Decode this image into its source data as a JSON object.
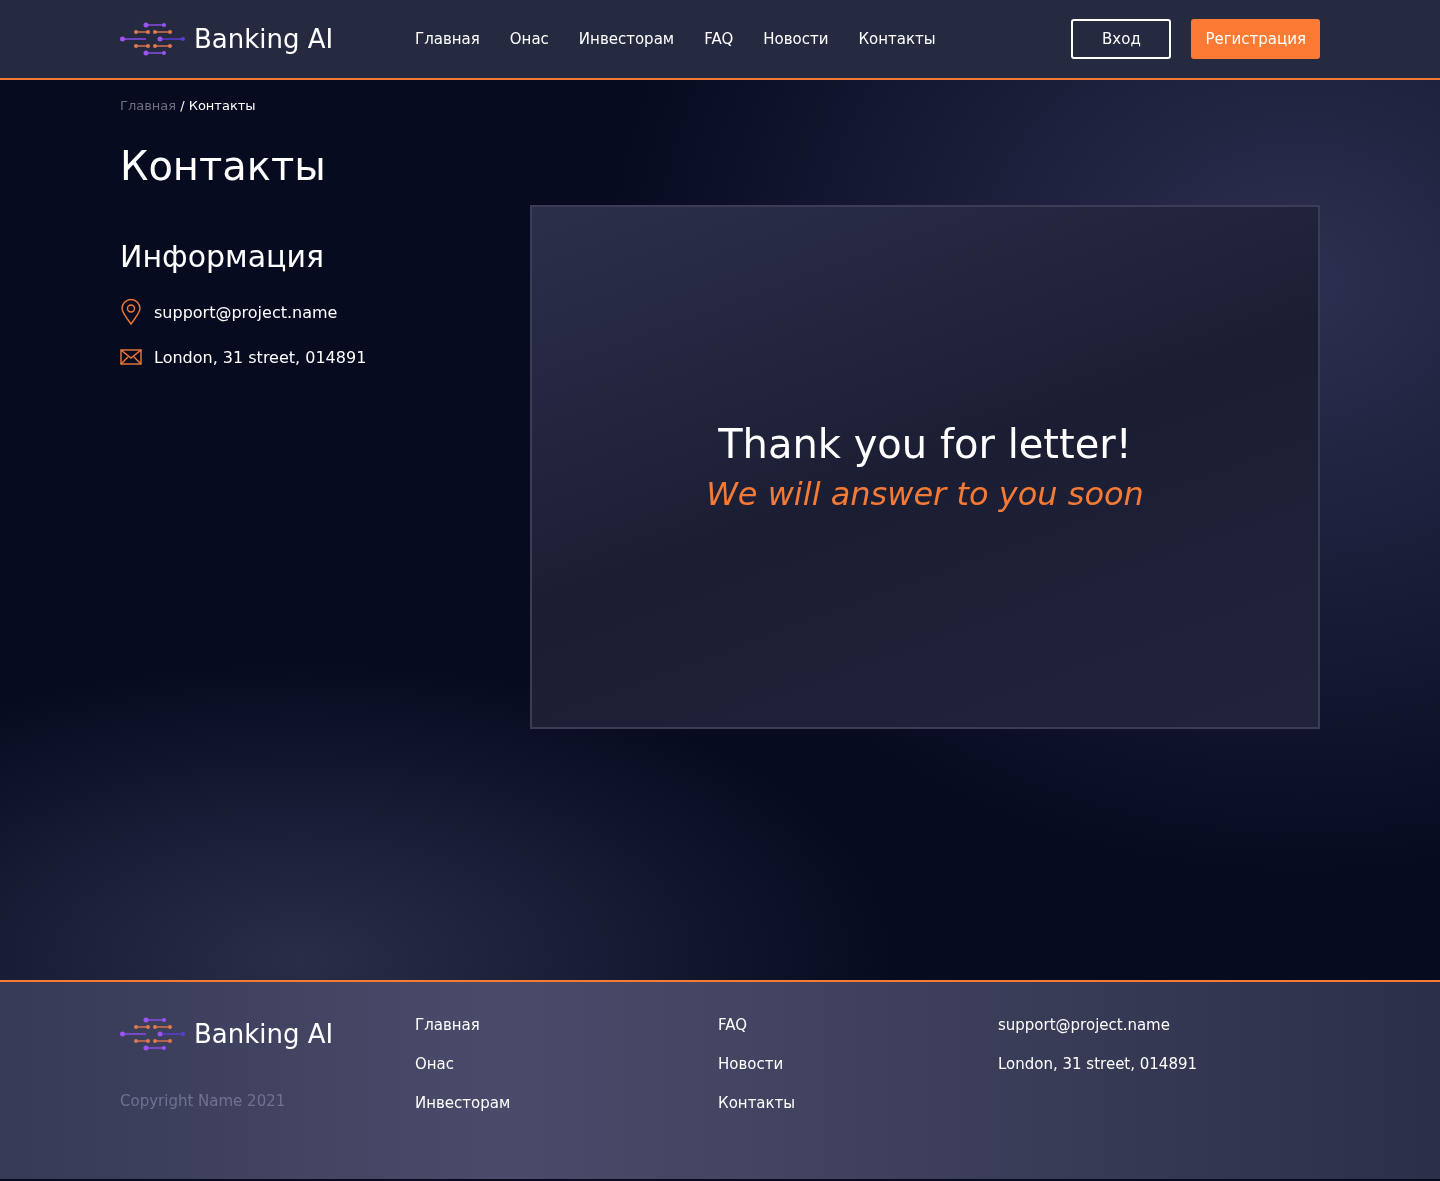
{
  "header": {
    "brand": "Banking AI",
    "nav": [
      "Главная",
      "Онас",
      "Инвесторам",
      "FAQ",
      "Новости",
      "Контакты"
    ],
    "login": "Вход",
    "register": "Регистрация"
  },
  "breadcrumbs": [
    {
      "label": "Главная",
      "current": false
    },
    {
      "label": "/ Контакты",
      "current": true
    }
  ],
  "title": "Контакты",
  "info": {
    "heading": "Информация",
    "items": [
      {
        "kind": "pin",
        "text": "support@project.name"
      },
      {
        "kind": "mail",
        "text": "London, 31 street, 014891"
      }
    ]
  },
  "message": {
    "title": "Thank you for letter!",
    "subtitle": "We will answer to you soon"
  },
  "footer": {
    "brand": "Banking AI",
    "copyright": "Copyright Name 2021",
    "columns": [
      [
        "Главная",
        "Онас",
        "Инвесторам"
      ],
      [
        "FAQ",
        "Новости",
        "Контакты"
      ],
      [
        "support@project.name",
        "London, 31 street, 014891"
      ]
    ]
  }
}
